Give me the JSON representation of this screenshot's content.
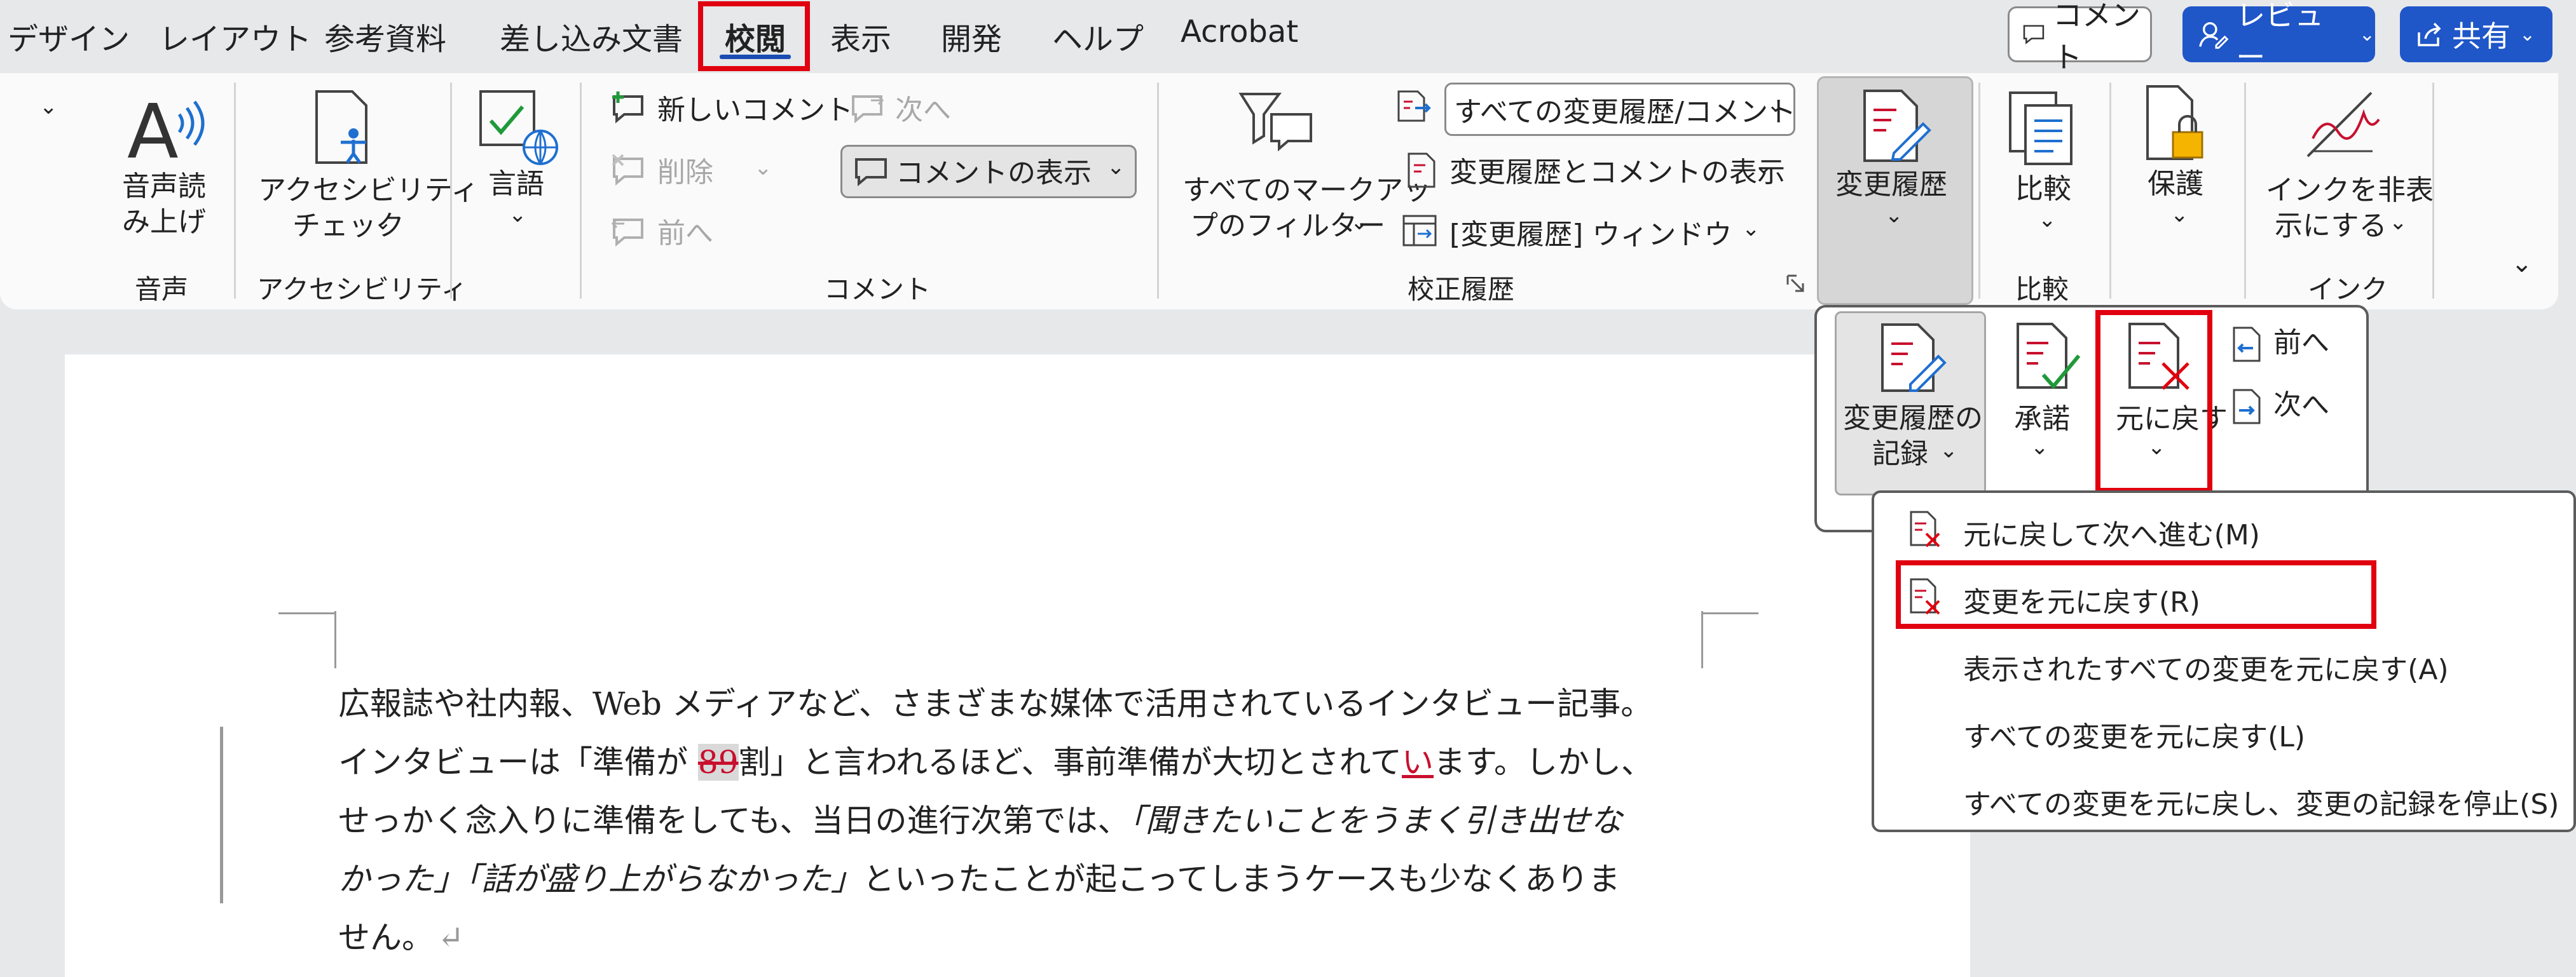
{
  "tabs": {
    "design": "デザイン",
    "layout": "レイアウト",
    "references": "参考資料",
    "mailings": "差し込み文書",
    "review": "校閲",
    "view": "表示",
    "developer": "開発",
    "help": "ヘルプ",
    "acrobat": "Acrobat"
  },
  "top_buttons": {
    "comment": "コメント",
    "review": "レビュー",
    "share": "共有"
  },
  "ribbon": {
    "speech": {
      "read_aloud_1": "音声読",
      "read_aloud_2": "み上げ",
      "group": "音声"
    },
    "accessibility": {
      "check_1": "アクセシビリティ",
      "check_2": "チェック",
      "group": "アクセシビリティ"
    },
    "language": {
      "label": "言語"
    },
    "comments": {
      "new": "新しいコメント",
      "delete": "削除",
      "previous": "前へ",
      "next": "次へ",
      "show": "コメントの表示",
      "group": "コメント"
    },
    "tracking": {
      "filter_1": "すべてのマークアッ",
      "filter_2": "プのフィルター",
      "display_select": "すべての変更履歴/コメント",
      "show_markup": "変更履歴とコメントの表示",
      "pane": "[変更履歴] ウィンドウ",
      "group": "校正履歴",
      "track_changes": "変更履歴"
    },
    "compare": {
      "label": "比較",
      "group": "比較"
    },
    "protect": {
      "label": "保護"
    },
    "ink": {
      "hide_1": "インクを非表",
      "hide_2": "示にする",
      "group": "インク"
    }
  },
  "track_panel": {
    "record_1": "変更履歴の",
    "record_2": "記録",
    "accept": "承諾",
    "reject": "元に戻す",
    "previous": "前へ",
    "next": "次へ"
  },
  "reject_menu": {
    "items": [
      {
        "label": "元に戻して次へ進む(M)",
        "enabled": true
      },
      {
        "label": "変更を元に戻す(R)",
        "enabled": true
      },
      {
        "label": "表示されたすべての変更を元に戻す(A)",
        "enabled": false
      },
      {
        "label": "すべての変更を元に戻す(L)",
        "enabled": true
      },
      {
        "label": "すべての変更を元に戻し、変更の記録を停止(S)",
        "enabled": true
      }
    ]
  },
  "document": {
    "line1": "広報誌や社内報、Web メディアなど、さまざまな媒体で活用されているインタビュー記事。",
    "line2_a": "インタビューは「準備が ",
    "line2_deleted": "89",
    "line2_b": "割」と言われるほど、事前準備が大切とされて",
    "line2_inserted": "い",
    "line2_c": "ます。しかし、",
    "line3_a": "せっかく念入りに準備をしても、当日の進行次第では、",
    "line3_italic": "「聞きたいことをうまく引き出せな",
    "line4_italic": "かった」「話が盛り上がらなかった」",
    "line4_b": "といったことが起こってしまうケースも少なくありま",
    "line5": "せん。",
    "para_mark": "↵"
  },
  "colors": {
    "accent": "#1f56c8",
    "highlight": "#e0000f",
    "revision": "#c8102e"
  }
}
